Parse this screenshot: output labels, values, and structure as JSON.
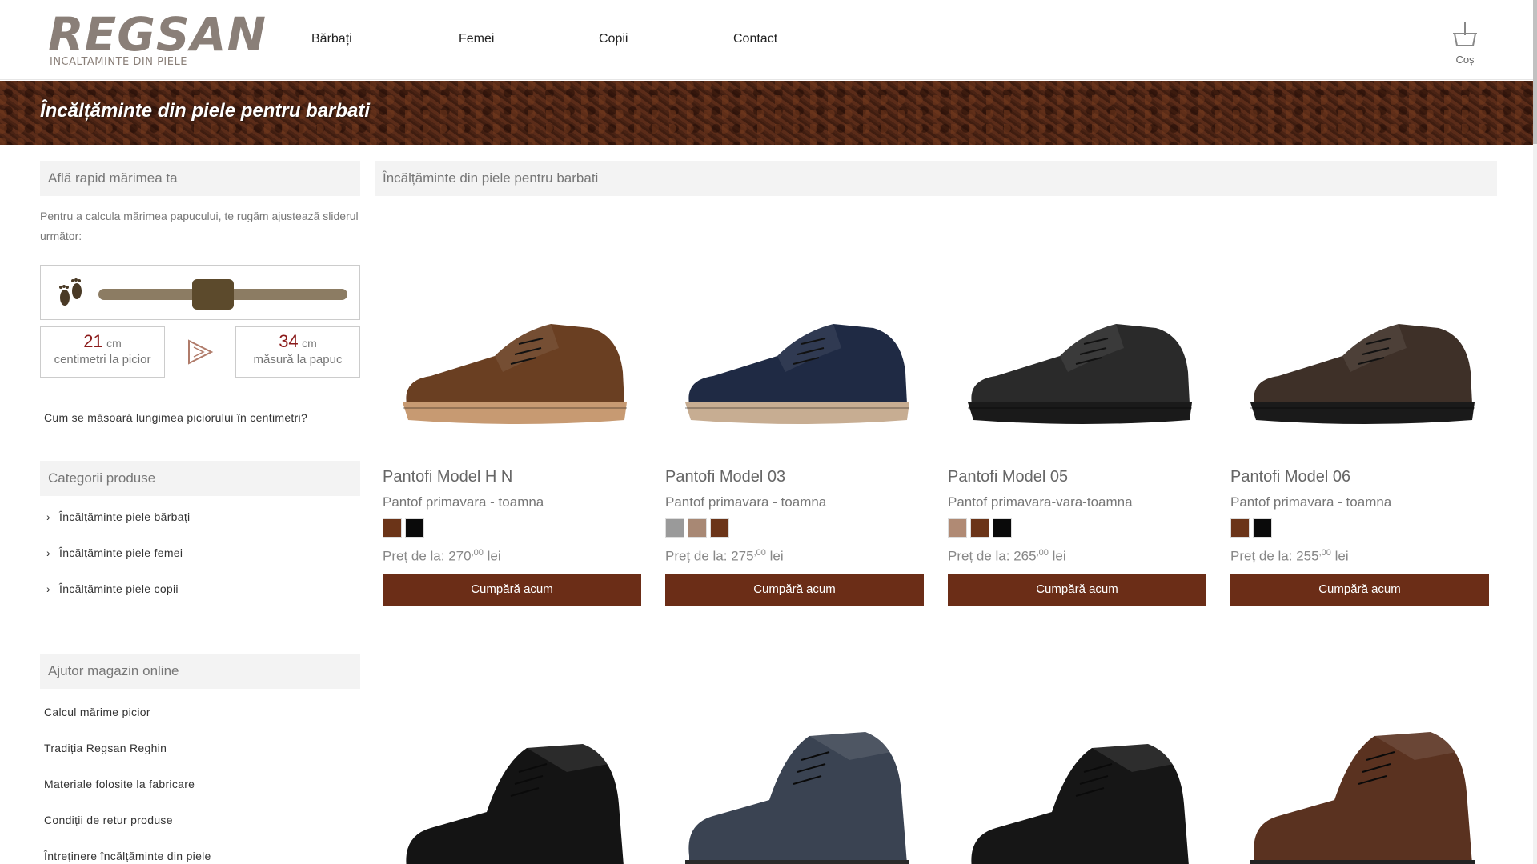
{
  "header": {
    "logo_main": "REGSAN",
    "logo_sub": "INCALTAMINTE DIN PIELE",
    "nav": [
      "Bărbați",
      "Femei",
      "Copii",
      "Contact"
    ],
    "cart_label": "Coș",
    "cart_icon": "basket-icon"
  },
  "banner": {
    "title": "Încălțăminte din piele pentru barbati"
  },
  "sidebar": {
    "size_title": "Află rapid mărimea ta",
    "size_text": "Pentru a calcula mărimea papucului, te rugăm ajustează sliderul următor:",
    "slider_icon": "feet-icon",
    "slider_level": 0.45,
    "foot_cm": "21",
    "foot_unit": "cm",
    "foot_caption": "centimetri la picior",
    "shoe_cm": "34",
    "shoe_unit": "cm",
    "shoe_caption": "măsură la papuc",
    "measure_link": "Cum se măsoară lungimea piciorului în centimetri?",
    "categories_title": "Categorii produse",
    "categories": [
      "Încălțăminte piele bărbați",
      "Încălțăminte piele femei",
      "Încălțăminte piele copii"
    ],
    "help_title": "Ajutor magazin online",
    "help_links": [
      "Calcul mărime picior",
      "Tradiția Regsan Reghin",
      "Materiale folosite la fabricare",
      "Condiții de retur produse",
      "Întreținere încălțăminte din piele"
    ]
  },
  "main": {
    "title": "Încălțăminte din piele pentru barbati",
    "products": [
      {
        "name": "Pantofi Model H N",
        "desc": "Pantof primavara - toamna",
        "swatches": [
          "#6b3418",
          "#0a0a0a"
        ],
        "price_prefix": "Preț de la: ",
        "price": "270",
        "price_dec": ",00",
        "currency": " lei",
        "button": "Cumpără acum",
        "shoe_color": "#6a3f22",
        "sole": "#c79a72"
      },
      {
        "name": "Pantofi Model 03",
        "desc": "Pantof primavara - toamna",
        "swatches": [
          "#9a9a9a",
          "#a88874",
          "#6b3418"
        ],
        "price_prefix": "Preț de la: ",
        "price": "275",
        "price_dec": ",00",
        "currency": " lei",
        "button": "Cumpără acum",
        "shoe_color": "#1f2a44",
        "sole": "#c7ad92"
      },
      {
        "name": "Pantofi Model 05",
        "desc": "Pantof primavara-vara-toamna",
        "swatches": [
          "#b08a74",
          "#6b3418",
          "#0a0a0a"
        ],
        "price_prefix": "Preț de la: ",
        "price": "265",
        "price_dec": ",00",
        "currency": " lei",
        "button": "Cumpără acum",
        "shoe_color": "#2a2a2a",
        "sole": "#1a1a1a"
      },
      {
        "name": "Pantofi Model 06",
        "desc": "Pantof primavara - toamna",
        "swatches": [
          "#6b3418",
          "#0a0a0a"
        ],
        "price_prefix": "Preț de la: ",
        "price": "255",
        "price_dec": ",00",
        "currency": " lei",
        "button": "Cumpără acum",
        "shoe_color": "#3e3028",
        "sole": "#1a1a1a"
      }
    ],
    "row2_shoes": [
      {
        "shoe_color": "#141414",
        "sole": "#2a2a2a"
      },
      {
        "shoe_color": "#3a4352",
        "sole": "#2a2a2a"
      },
      {
        "shoe_color": "#161616",
        "sole": "#1a1a1a"
      },
      {
        "shoe_color": "#5a3220",
        "sole": "#222"
      }
    ]
  }
}
